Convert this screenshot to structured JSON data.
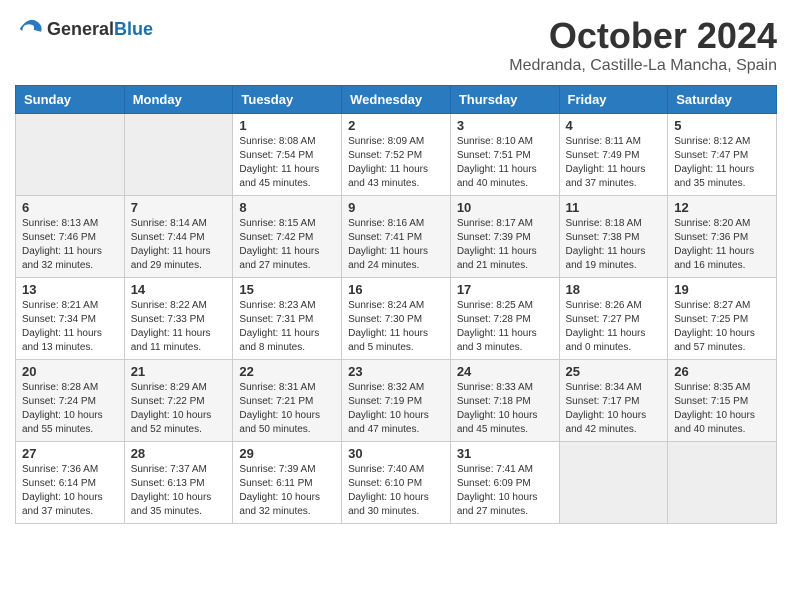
{
  "header": {
    "logo_general": "General",
    "logo_blue": "Blue",
    "month_title": "October 2024",
    "location": "Medranda, Castille-La Mancha, Spain"
  },
  "weekdays": [
    "Sunday",
    "Monday",
    "Tuesday",
    "Wednesday",
    "Thursday",
    "Friday",
    "Saturday"
  ],
  "weeks": [
    [
      {
        "day": "",
        "empty": true
      },
      {
        "day": "",
        "empty": true
      },
      {
        "day": "1",
        "sunrise": "8:08 AM",
        "sunset": "7:54 PM",
        "daylight": "11 hours and 45 minutes."
      },
      {
        "day": "2",
        "sunrise": "8:09 AM",
        "sunset": "7:52 PM",
        "daylight": "11 hours and 43 minutes."
      },
      {
        "day": "3",
        "sunrise": "8:10 AM",
        "sunset": "7:51 PM",
        "daylight": "11 hours and 40 minutes."
      },
      {
        "day": "4",
        "sunrise": "8:11 AM",
        "sunset": "7:49 PM",
        "daylight": "11 hours and 37 minutes."
      },
      {
        "day": "5",
        "sunrise": "8:12 AM",
        "sunset": "7:47 PM",
        "daylight": "11 hours and 35 minutes."
      }
    ],
    [
      {
        "day": "6",
        "sunrise": "8:13 AM",
        "sunset": "7:46 PM",
        "daylight": "11 hours and 32 minutes."
      },
      {
        "day": "7",
        "sunrise": "8:14 AM",
        "sunset": "7:44 PM",
        "daylight": "11 hours and 29 minutes."
      },
      {
        "day": "8",
        "sunrise": "8:15 AM",
        "sunset": "7:42 PM",
        "daylight": "11 hours and 27 minutes."
      },
      {
        "day": "9",
        "sunrise": "8:16 AM",
        "sunset": "7:41 PM",
        "daylight": "11 hours and 24 minutes."
      },
      {
        "day": "10",
        "sunrise": "8:17 AM",
        "sunset": "7:39 PM",
        "daylight": "11 hours and 21 minutes."
      },
      {
        "day": "11",
        "sunrise": "8:18 AM",
        "sunset": "7:38 PM",
        "daylight": "11 hours and 19 minutes."
      },
      {
        "day": "12",
        "sunrise": "8:20 AM",
        "sunset": "7:36 PM",
        "daylight": "11 hours and 16 minutes."
      }
    ],
    [
      {
        "day": "13",
        "sunrise": "8:21 AM",
        "sunset": "7:34 PM",
        "daylight": "11 hours and 13 minutes."
      },
      {
        "day": "14",
        "sunrise": "8:22 AM",
        "sunset": "7:33 PM",
        "daylight": "11 hours and 11 minutes."
      },
      {
        "day": "15",
        "sunrise": "8:23 AM",
        "sunset": "7:31 PM",
        "daylight": "11 hours and 8 minutes."
      },
      {
        "day": "16",
        "sunrise": "8:24 AM",
        "sunset": "7:30 PM",
        "daylight": "11 hours and 5 minutes."
      },
      {
        "day": "17",
        "sunrise": "8:25 AM",
        "sunset": "7:28 PM",
        "daylight": "11 hours and 3 minutes."
      },
      {
        "day": "18",
        "sunrise": "8:26 AM",
        "sunset": "7:27 PM",
        "daylight": "11 hours and 0 minutes."
      },
      {
        "day": "19",
        "sunrise": "8:27 AM",
        "sunset": "7:25 PM",
        "daylight": "10 hours and 57 minutes."
      }
    ],
    [
      {
        "day": "20",
        "sunrise": "8:28 AM",
        "sunset": "7:24 PM",
        "daylight": "10 hours and 55 minutes."
      },
      {
        "day": "21",
        "sunrise": "8:29 AM",
        "sunset": "7:22 PM",
        "daylight": "10 hours and 52 minutes."
      },
      {
        "day": "22",
        "sunrise": "8:31 AM",
        "sunset": "7:21 PM",
        "daylight": "10 hours and 50 minutes."
      },
      {
        "day": "23",
        "sunrise": "8:32 AM",
        "sunset": "7:19 PM",
        "daylight": "10 hours and 47 minutes."
      },
      {
        "day": "24",
        "sunrise": "8:33 AM",
        "sunset": "7:18 PM",
        "daylight": "10 hours and 45 minutes."
      },
      {
        "day": "25",
        "sunrise": "8:34 AM",
        "sunset": "7:17 PM",
        "daylight": "10 hours and 42 minutes."
      },
      {
        "day": "26",
        "sunrise": "8:35 AM",
        "sunset": "7:15 PM",
        "daylight": "10 hours and 40 minutes."
      }
    ],
    [
      {
        "day": "27",
        "sunrise": "7:36 AM",
        "sunset": "6:14 PM",
        "daylight": "10 hours and 37 minutes."
      },
      {
        "day": "28",
        "sunrise": "7:37 AM",
        "sunset": "6:13 PM",
        "daylight": "10 hours and 35 minutes."
      },
      {
        "day": "29",
        "sunrise": "7:39 AM",
        "sunset": "6:11 PM",
        "daylight": "10 hours and 32 minutes."
      },
      {
        "day": "30",
        "sunrise": "7:40 AM",
        "sunset": "6:10 PM",
        "daylight": "10 hours and 30 minutes."
      },
      {
        "day": "31",
        "sunrise": "7:41 AM",
        "sunset": "6:09 PM",
        "daylight": "10 hours and 27 minutes."
      },
      {
        "day": "",
        "empty": true
      },
      {
        "day": "",
        "empty": true
      }
    ]
  ],
  "labels": {
    "sunrise_prefix": "Sunrise: ",
    "sunset_prefix": "Sunset: ",
    "daylight_prefix": "Daylight: "
  }
}
